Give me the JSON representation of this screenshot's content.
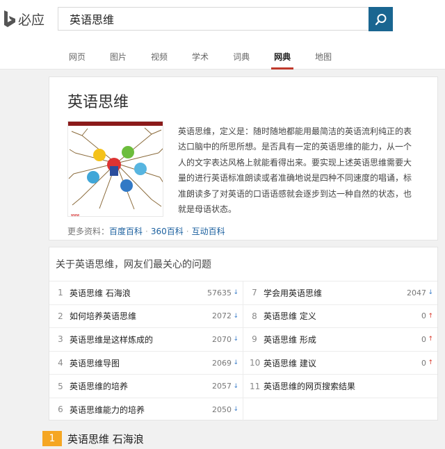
{
  "header": {
    "logo_text": "必应",
    "search_value": "英语思维",
    "tabs": [
      "网页",
      "图片",
      "视频",
      "学术",
      "词典",
      "网典",
      "地图"
    ],
    "active_tab": "网典",
    "accent_color": "#1a6691"
  },
  "entry": {
    "title": "英语思维",
    "description": "英语思维，定义是：随时随地都能用最简洁的英语流利纯正的表达口脑中的所思所想。是否具有一定的英语思维的能力，从一个人的文字表达风格上就能看得出来。要实现上述英语思维需要大量的进行英语标准朗读或者准确地说是四种不同速度的唱诵，标准朗读多了对英语的口语语感就会逐步到达一种自然的状态，也就是母语状态。",
    "more_label": "更多资料：",
    "sources": [
      "百度百科",
      "360百科",
      "互动百科"
    ]
  },
  "qa": {
    "title": "关于英语思维，网友们最关心的问题",
    "left": [
      {
        "num": "1",
        "text": "英语思维 石海浪",
        "count": "57635",
        "trend": "down"
      },
      {
        "num": "2",
        "text": "如何培养英语思维",
        "count": "2072",
        "trend": "down"
      },
      {
        "num": "3",
        "text": "英语思维是这样炼成的",
        "count": "2070",
        "trend": "down"
      },
      {
        "num": "4",
        "text": "英语思维导图",
        "count": "2069",
        "trend": "down"
      },
      {
        "num": "5",
        "text": "英语思维的培养",
        "count": "2057",
        "trend": "down"
      },
      {
        "num": "6",
        "text": "英语思维能力的培养",
        "count": "2050",
        "trend": "down"
      }
    ],
    "right": [
      {
        "num": "7",
        "text": "学会用英语思维",
        "count": "2047",
        "trend": "down"
      },
      {
        "num": "8",
        "text": "英语思维 定义",
        "count": "0",
        "trend": "up"
      },
      {
        "num": "9",
        "text": "英语思维 形成",
        "count": "0",
        "trend": "up"
      },
      {
        "num": "10",
        "text": "英语思维 建议",
        "count": "0",
        "trend": "up"
      },
      {
        "num": "11",
        "text": "英语思维的网页搜索结果",
        "count": "",
        "trend": ""
      },
      {
        "num": "",
        "text": "",
        "count": "",
        "trend": ""
      }
    ]
  },
  "result": {
    "num": "1",
    "title": "英语思维 石海浪"
  }
}
